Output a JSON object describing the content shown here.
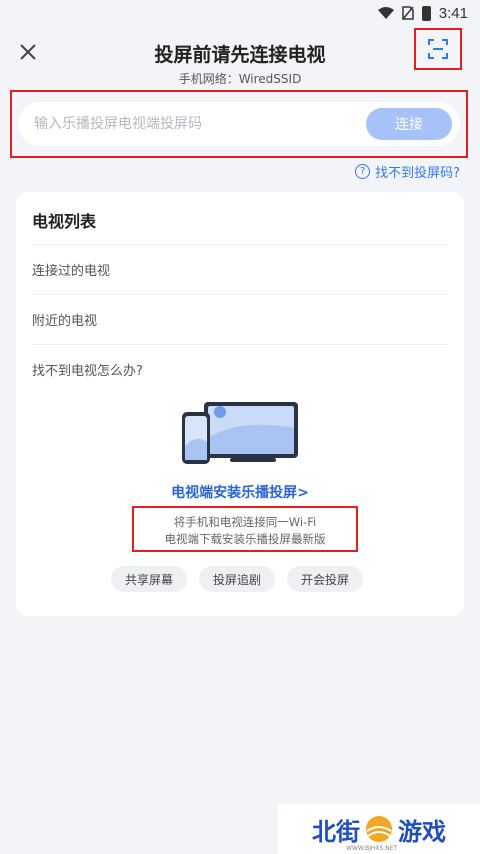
{
  "status_bar": {
    "time": "3:41"
  },
  "header": {
    "title": "投屏前请先连接电视",
    "network_label": "手机网络：WiredSSID"
  },
  "connect": {
    "placeholder": "输入乐播投屏电视端投屏码",
    "button_label": "连接"
  },
  "help_link": {
    "icon_text": "?",
    "label": "找不到投屏码?"
  },
  "tv_list": {
    "title": "电视列表",
    "rows": [
      "连接过的电视",
      "附近的电视",
      "找不到电视怎么办?"
    ],
    "install_link": "电视端安装乐播投屏>",
    "tips": [
      "将手机和电视连接同一Wi-Fi",
      "电视端下载安装乐播投屏最新版"
    ],
    "chips": [
      "共享屏幕",
      "投屏追剧",
      "开会投屏"
    ]
  },
  "watermark": {
    "text_left": "北街",
    "text_right": "游戏",
    "sub": "WWW.BJHXS.NET"
  },
  "colors": {
    "accent": "#3579f0",
    "connect_button": "#a7c2f7",
    "highlight": "#e02020"
  }
}
